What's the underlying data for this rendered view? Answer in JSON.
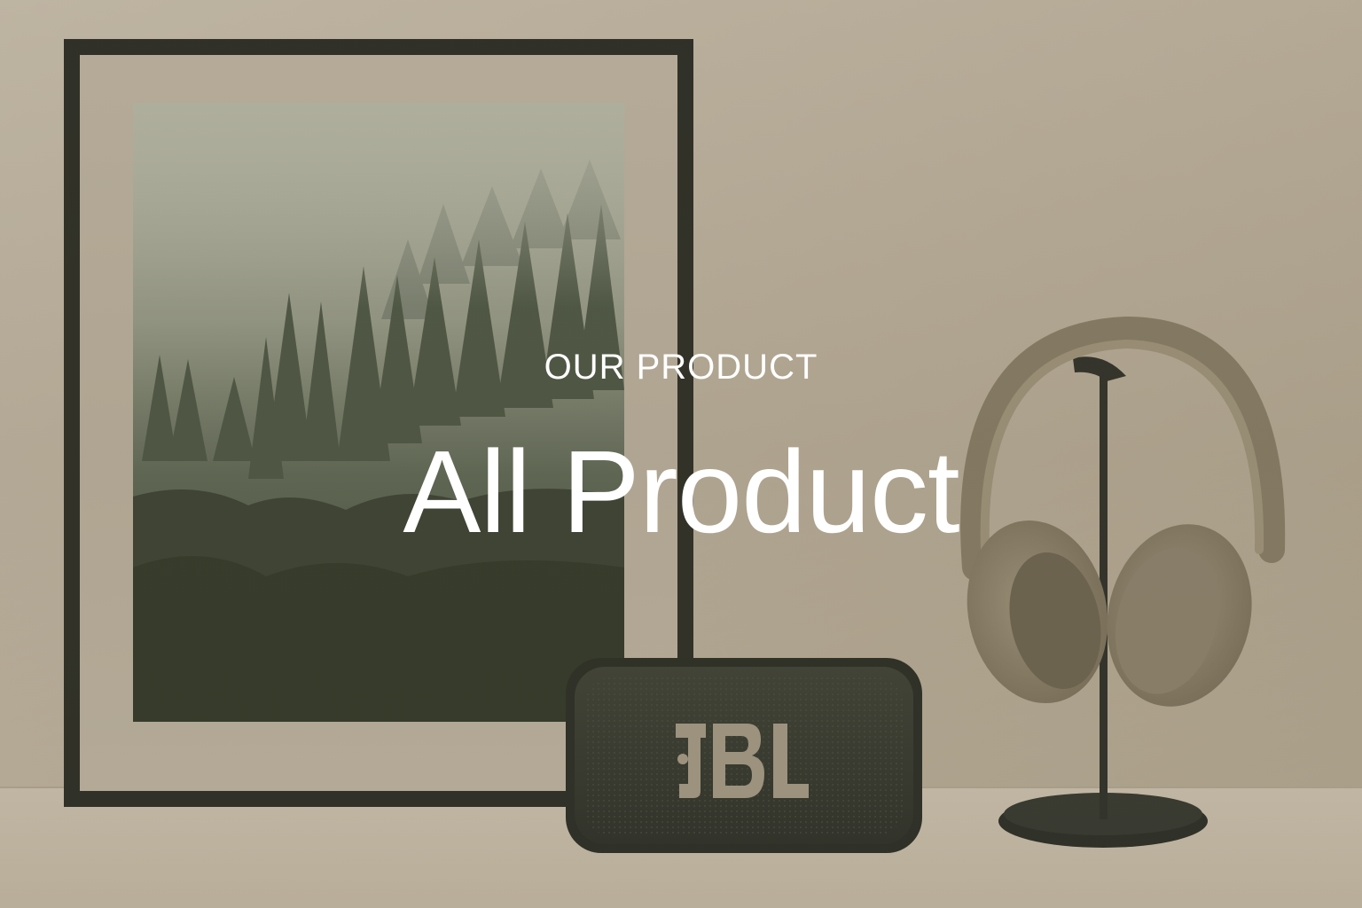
{
  "hero": {
    "eyebrow": "OUR PRODUCT",
    "title": "All Product",
    "text_color": "#ffffff",
    "overlay_color": "#5b4f36"
  },
  "scene": {
    "framed_poster": "misty-forest-poster",
    "speaker_brand": "JBL",
    "headphones": "over-ear-headphones",
    "stand": "headphone-stand"
  }
}
